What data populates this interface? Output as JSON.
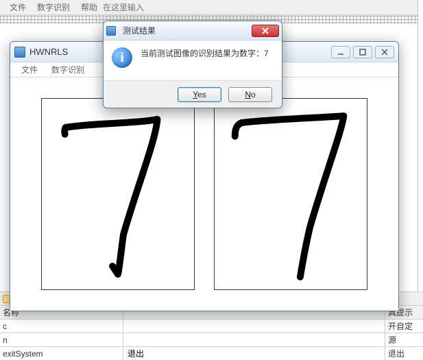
{
  "bg_menu": {
    "file": "文件",
    "recognize": "数字识别",
    "help": "帮助",
    "input_placeholder": "在这里输入"
  },
  "hw_window": {
    "title": "HWNRLS",
    "menu": {
      "file": "文件",
      "recognize": "数字识别"
    },
    "buttons": {
      "min": "minimize",
      "max": "maximize",
      "close": "close"
    }
  },
  "dialog": {
    "title": "测试结果",
    "message": "当前测试图像的识别结果为数字：7",
    "yes_label": "Yes",
    "no_label": "No"
  },
  "footer": {
    "name_header": "名称",
    "rows": [
      {
        "l": "c",
        "r": "具提示"
      },
      {
        "l": "n",
        "r": "开自定"
      },
      {
        "l": "exitSystem",
        "m": "退出",
        "r": "退出"
      }
    ],
    "mid_word": "源"
  }
}
